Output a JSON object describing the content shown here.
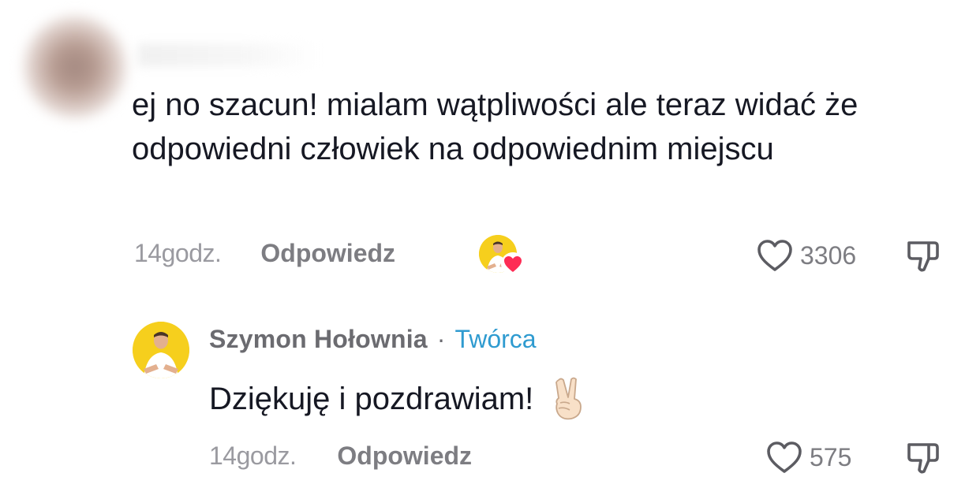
{
  "comment": {
    "text": "ej no szacun! mialam wątpliwości ale teraz widać że odpowiedni człowiek na odpowiednim miejscu",
    "time": "14godz.",
    "reply_label": "Odpowiedz",
    "likes": "3306"
  },
  "reply": {
    "author": "Szymon Hołownia",
    "separator": "·",
    "badge": "Twórca",
    "text": "Dziękuję i pozdrawiam!",
    "time": "14godz.",
    "reply_label": "Odpowiedz",
    "likes": "575"
  },
  "icons": {
    "like": "heart-outline-icon",
    "dislike": "thumbs-down-icon",
    "creator_liked": "creator-liked-heart-icon",
    "emoji": "victory-hand-emoji"
  },
  "colors": {
    "text": "#161823",
    "muted": "#9a9aa0",
    "reply_label": "#7d7d82",
    "badge": "#2f9bd0",
    "heart_red": "#fe2c55",
    "avatar_yellow": "#f6cf1d"
  }
}
